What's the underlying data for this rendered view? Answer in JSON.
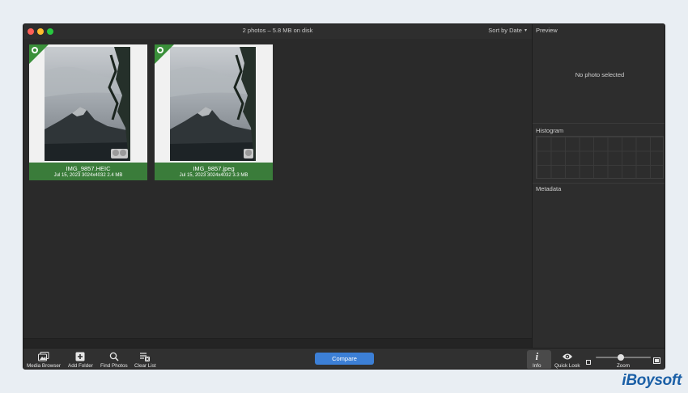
{
  "window": {
    "title": "2 photos – 5.8 MB on disk",
    "sort_label": "Sort by Date",
    "sort_caret": "▾"
  },
  "photos": [
    {
      "name": "IMG_9857.HEIC",
      "meta": "Jul 15, 2023  3024x4032  2.4 MB"
    },
    {
      "name": "IMG_9857.jpeg",
      "meta": "Jul 15, 2023  3024x4032  3.3 MB"
    }
  ],
  "sidebar": {
    "preview_title": "Preview",
    "no_photo": "No photo selected",
    "histogram_title": "Histogram",
    "metadata_title": "Metadata"
  },
  "toolbar": {
    "media_browser": "Media Browser",
    "add_folder": "Add Folder",
    "find_photos": "Find Photos",
    "clear_list": "Clear List",
    "compare": "Compare",
    "info": "Info",
    "quick_look": "Quick Look",
    "zoom": "Zoom",
    "zoom_level": 0.45
  },
  "colors": {
    "selected_caption": "#3a7c3a",
    "compare_button": "#3c7fd6"
  },
  "brand": "iBoysoft"
}
